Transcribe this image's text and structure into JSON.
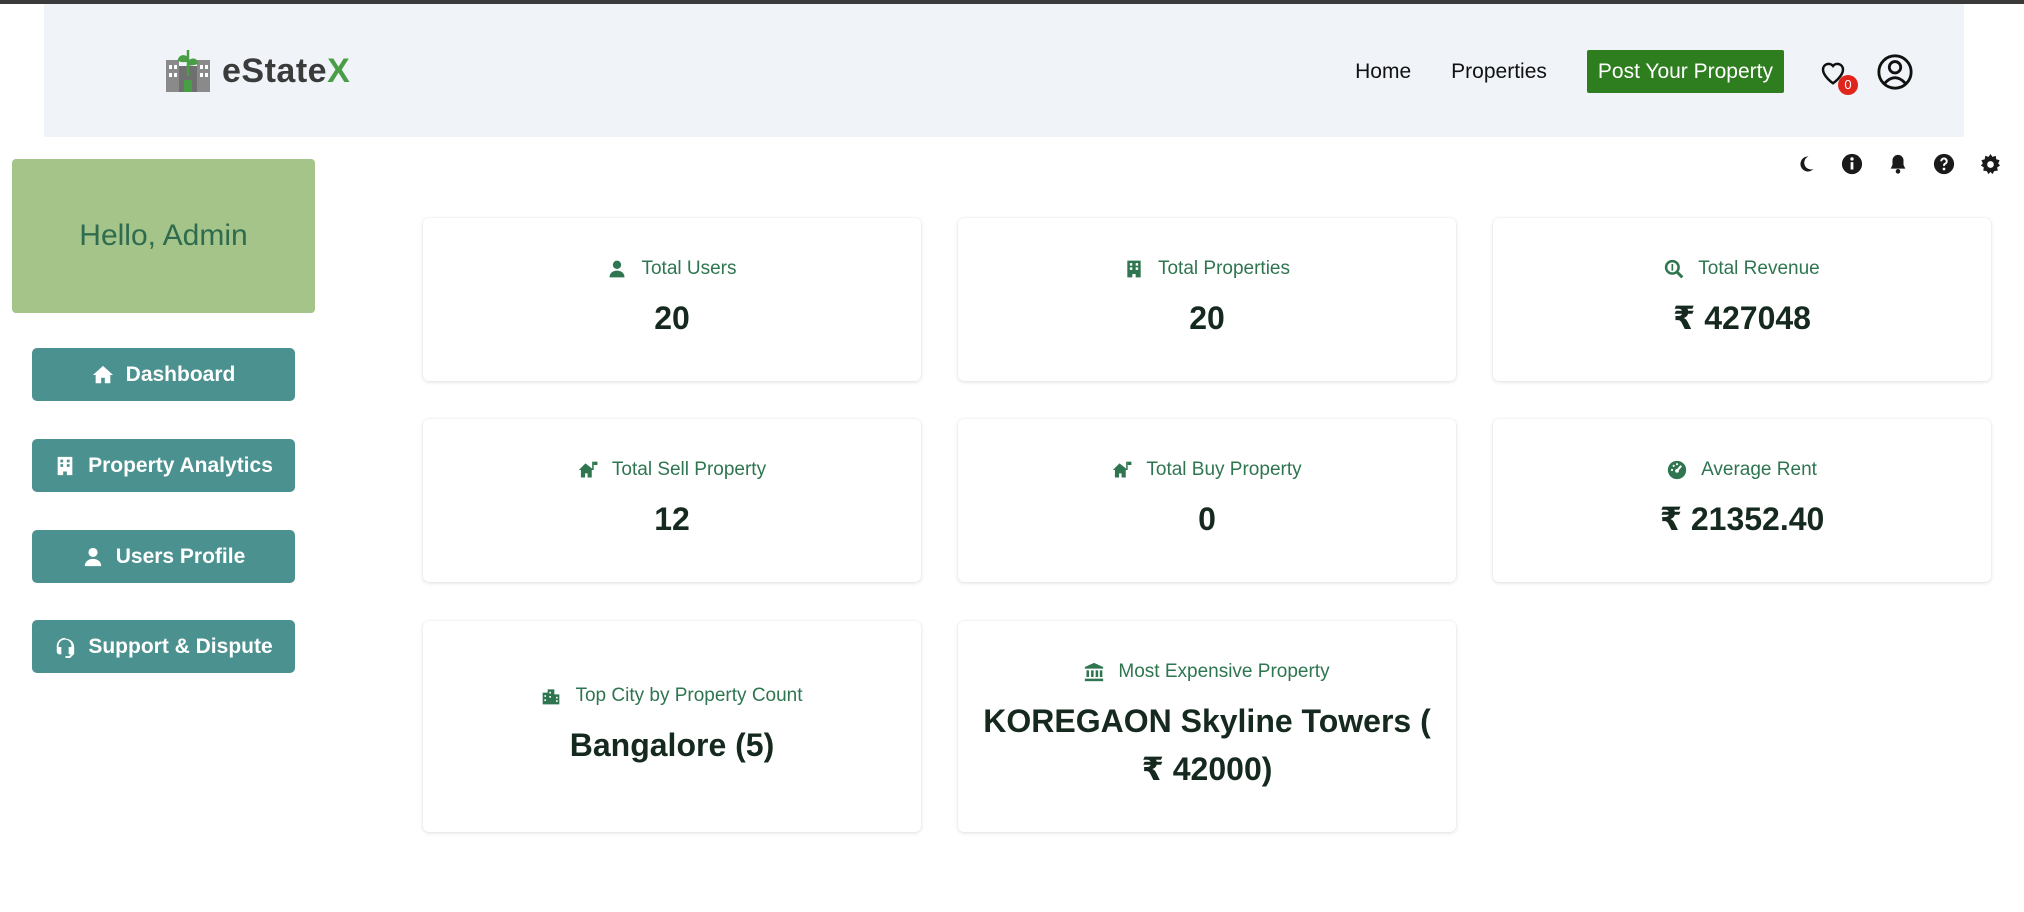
{
  "app": {
    "name_main": "eState",
    "name_accent": "X"
  },
  "nav": {
    "home": "Home",
    "properties": "Properties",
    "post": "Post Your Property",
    "wishlist_count": "0"
  },
  "toolbar": {
    "icons": [
      "moon-icon",
      "info-icon",
      "bell-icon",
      "help-icon",
      "gear-icon"
    ]
  },
  "sidebar": {
    "greeting": "Hello, Admin",
    "items": [
      {
        "label": "Dashboard",
        "icon": "home-icon"
      },
      {
        "label": "Property Analytics",
        "icon": "building-icon"
      },
      {
        "label": "Users Profile",
        "icon": "user-icon"
      },
      {
        "label": "Support & Dispute",
        "icon": "headset-icon"
      }
    ]
  },
  "stats": {
    "total_users": {
      "label": "Total Users",
      "value": "20"
    },
    "total_properties": {
      "label": "Total Properties",
      "value": "20"
    },
    "total_revenue": {
      "label": "Total Revenue",
      "value": "₹ 427048"
    },
    "total_sell": {
      "label": "Total Sell Property",
      "value": "12"
    },
    "total_buy": {
      "label": "Total Buy Property",
      "value": "0"
    },
    "average_rent": {
      "label": "Average Rent",
      "value": "₹ 21352.40"
    },
    "top_city": {
      "label": "Top City by Property Count",
      "value": "Bangalore (5)"
    },
    "most_expensive": {
      "label": "Most Expensive Property",
      "value": "KOREGAON Skyline Towers ( ₹ 42000)"
    }
  },
  "colors": {
    "accent_green": "#2e7d1f",
    "sidebar_button": "#4a918f",
    "greeting_bg": "#a5c489",
    "card_label": "#2e7550"
  }
}
